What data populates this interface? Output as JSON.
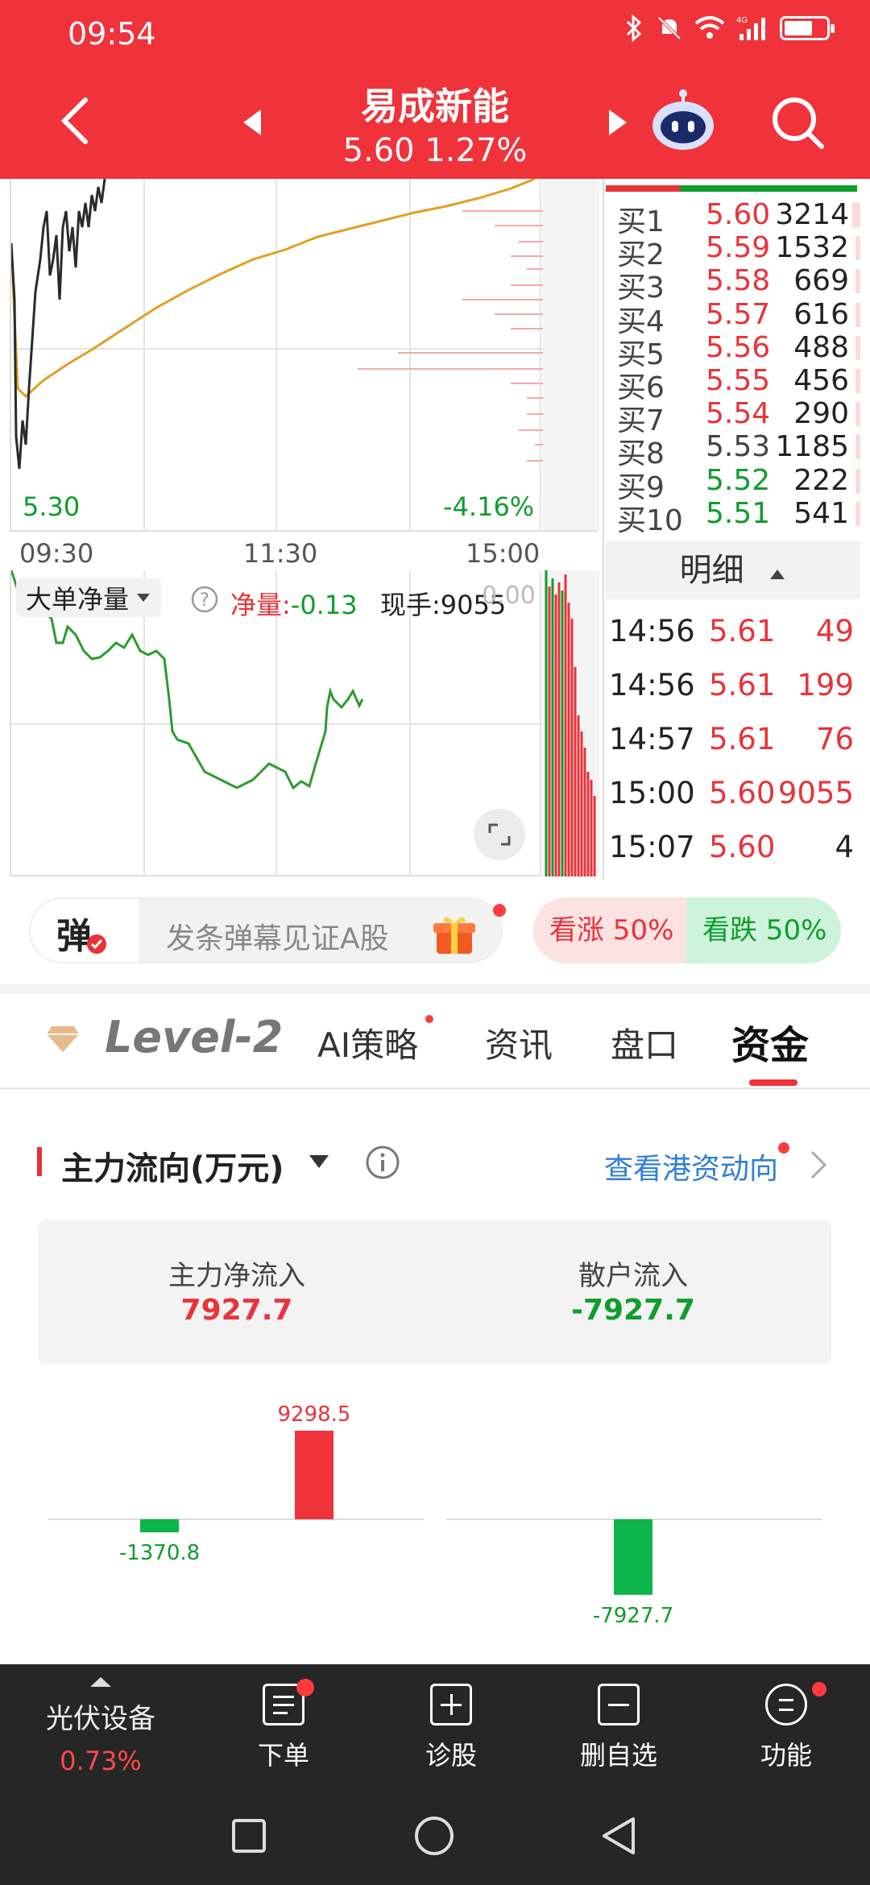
{
  "status_bar": {
    "time": "09:54"
  },
  "header": {
    "stock_name": "易成新能",
    "price_change": "5.60 1.27%"
  },
  "chart": {
    "low_label": "5.30",
    "pct_label": "-4.16%",
    "time_axis": [
      "09:30",
      "11:30",
      "15:00"
    ],
    "indicator_name": "大单净量",
    "net_label": "净量:",
    "net_value": "-0.13",
    "volume_text": "现手:9055",
    "partial_text": "0.00"
  },
  "order_book": {
    "bids": [
      {
        "label": "买1",
        "price": "5.60",
        "volume": "3214",
        "color": "red"
      },
      {
        "label": "买2",
        "price": "5.59",
        "volume": "1532",
        "color": "red"
      },
      {
        "label": "买3",
        "price": "5.58",
        "volume": "669",
        "color": "red"
      },
      {
        "label": "买4",
        "price": "5.57",
        "volume": "616",
        "color": "red"
      },
      {
        "label": "买5",
        "price": "5.56",
        "volume": "488",
        "color": "red"
      },
      {
        "label": "买6",
        "price": "5.55",
        "volume": "456",
        "color": "red"
      },
      {
        "label": "买7",
        "price": "5.54",
        "volume": "290",
        "color": "red"
      },
      {
        "label": "买8",
        "price": "5.53",
        "volume": "1185",
        "color": "gray"
      },
      {
        "label": "买9",
        "price": "5.52",
        "volume": "222",
        "color": "green"
      },
      {
        "label": "买10",
        "price": "5.51",
        "volume": "541",
        "color": "green"
      }
    ]
  },
  "detail": {
    "header": "明细",
    "ticks": [
      {
        "time": "14:56",
        "price": "5.61",
        "volume": "49"
      },
      {
        "time": "14:56",
        "price": "5.61",
        "volume": "199"
      },
      {
        "time": "14:57",
        "price": "5.61",
        "volume": "76"
      },
      {
        "time": "15:00",
        "price": "5.60",
        "volume": "9055"
      },
      {
        "time": "15:07",
        "price": "5.60",
        "volume": "4"
      }
    ]
  },
  "danmu": {
    "button": "弹",
    "placeholder": "发条弹幕见证A股",
    "bull": "看涨 50%",
    "bear": "看跌 50%"
  },
  "tabs": [
    "Level-2",
    "AI策略",
    "资讯",
    "盘口",
    "资金"
  ],
  "fund_flow": {
    "title": "主力流向(万元)",
    "link": "查看港资动向",
    "main_label": "主力净流入",
    "main_value": "7927.7",
    "retail_label": "散户流入",
    "retail_value": "-7927.7",
    "left_chart": {
      "values": [
        -1370.8,
        9298.5
      ],
      "labels": [
        "-1370.8",
        "9298.5"
      ]
    },
    "right_chart": {
      "values": [
        -7927.7
      ],
      "labels": [
        "-7927.7"
      ]
    }
  },
  "bottom_nav": {
    "sector_name": "光伏设备",
    "sector_change": "0.73%",
    "items": [
      "下单",
      "诊股",
      "删自选",
      "功能"
    ]
  },
  "colors": {
    "brand_red": "#f0323a",
    "up": "#e8333a",
    "down": "#0f9d2c",
    "avg_line": "#e0a020"
  }
}
